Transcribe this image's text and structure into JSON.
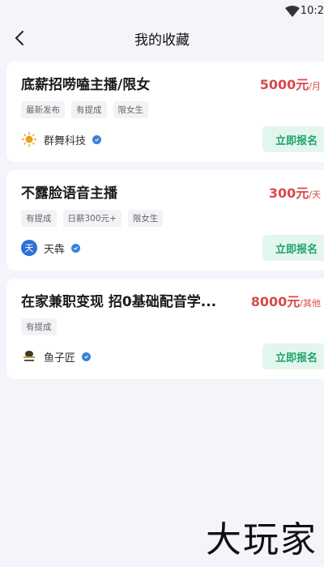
{
  "status_bar": {
    "time": "10:2"
  },
  "header": {
    "title": "我的收藏"
  },
  "jobs": [
    {
      "title": "底薪招唠嗑主播/限女",
      "salary_amount": "5000元",
      "salary_unit": "/月",
      "tags": [
        "最新发布",
        "有提成",
        "限女生"
      ],
      "company": "群舞科技",
      "apply_label": "立即报名"
    },
    {
      "title": "不露脸语音主播",
      "salary_amount": "300元",
      "salary_unit": "/天",
      "tags": [
        "有提成",
        "日薪300元+",
        "限女生"
      ],
      "company": "天犇",
      "logo_text": "天",
      "apply_label": "立即报名"
    },
    {
      "title": "在家兼职变现 招0基础配音学...",
      "salary_amount": "8000元",
      "salary_unit": "/其他",
      "tags": [
        "有提成"
      ],
      "company": "鱼子匠",
      "apply_label": "立即报名"
    }
  ],
  "watermark": "大玩家",
  "colors": {
    "background": "#f3f5fa",
    "salary": "#d84a4a",
    "apply_bg": "#e3f6ee",
    "apply_text": "#1ea56a",
    "verified": "#3b82d6"
  }
}
